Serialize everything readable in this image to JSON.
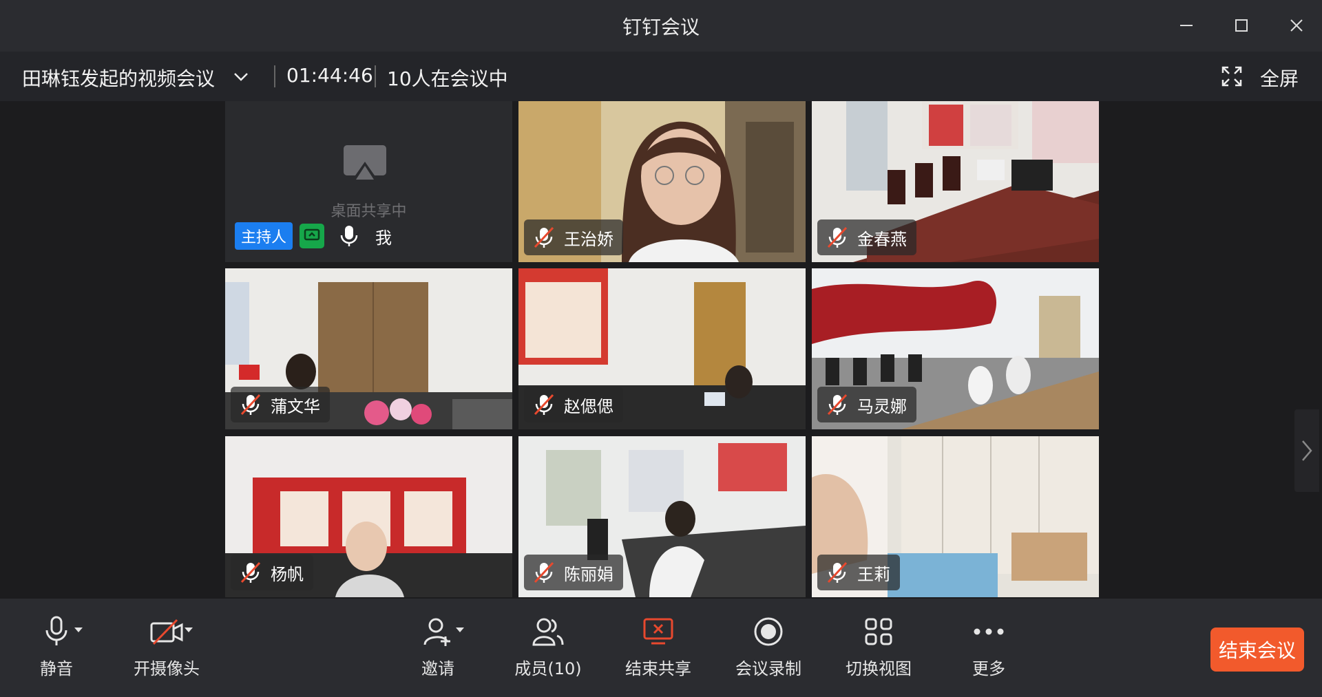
{
  "window": {
    "title": "钉钉会议"
  },
  "info": {
    "meeting_name": "田琳钰发起的视频会议",
    "timer": "01:44:46",
    "participants_count": "10人在会议中",
    "fullscreen_label": "全屏"
  },
  "shared_tile": {
    "status": "桌面共享中",
    "host_badge": "主持人",
    "self_label": "我"
  },
  "participants": [
    {
      "name": "王治娇"
    },
    {
      "name": "金春燕"
    },
    {
      "name": "蒲文华"
    },
    {
      "name": "赵偲偲"
    },
    {
      "name": "马灵娜"
    },
    {
      "name": "杨帆"
    },
    {
      "name": "陈丽娟"
    },
    {
      "name": "王莉"
    }
  ],
  "toolbar": {
    "mute": "静音",
    "camera": "开摄像头",
    "invite": "邀请",
    "members": "成员(10)",
    "stop_share": "结束共享",
    "record": "会议录制",
    "switch_view": "切换视图",
    "more": "更多",
    "end_meeting": "结束会议"
  },
  "colors": {
    "accent_blue": "#1b7ef0",
    "share_green": "#16a74a",
    "end_orange": "#f25a2c",
    "mute_red": "#e8492e"
  }
}
